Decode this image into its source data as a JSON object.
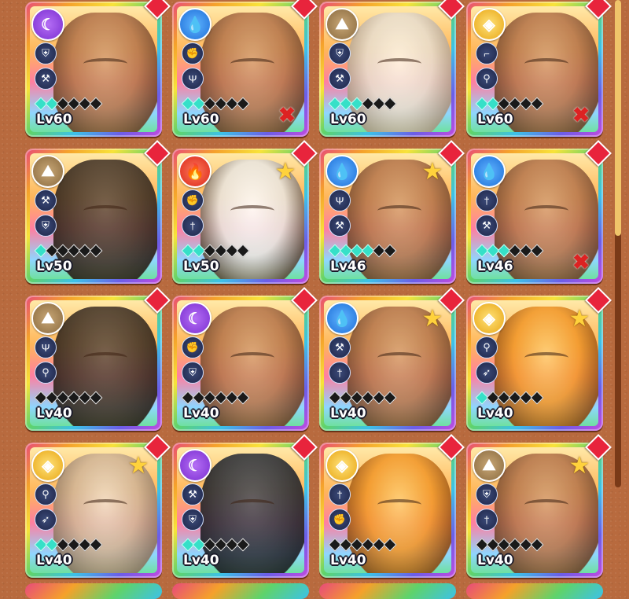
{
  "roster": {
    "cards": [
      {
        "level": "Lv60",
        "element": "el-moon",
        "element_glyph": "☾",
        "fur": "",
        "skills": [
          "shield-icon",
          "axe-icon"
        ],
        "rank": 2,
        "star": false,
        "xmark": false
      },
      {
        "level": "Lv60",
        "element": "el-water",
        "element_glyph": "💧",
        "fur": "",
        "skills": [
          "fist-icon",
          "trident-icon"
        ],
        "rank": 2,
        "star": false,
        "xmark": true
      },
      {
        "level": "Lv60",
        "element": "el-earth",
        "element_glyph": "⛰",
        "fur": "fur-white",
        "skills": [
          "shield-icon",
          "axe-icon"
        ],
        "rank": 3,
        "star": false,
        "xmark": false
      },
      {
        "level": "Lv60",
        "element": "el-light",
        "element_glyph": "◈",
        "fur": "",
        "skills": [
          "gun-icon",
          "staff-icon"
        ],
        "rank": 2,
        "star": false,
        "xmark": true
      },
      {
        "level": "Lv50",
        "element": "el-earth",
        "element_glyph": "⛰",
        "fur": "fur-dark",
        "skills": [
          "axe-icon",
          "shield-icon"
        ],
        "rank": 1,
        "star": false,
        "xmark": false
      },
      {
        "level": "Lv50",
        "element": "el-fire",
        "element_glyph": "🔥",
        "fur": "fur-panda",
        "skills": [
          "fist-icon",
          "sword-icon"
        ],
        "rank": 2,
        "star": true,
        "xmark": false
      },
      {
        "level": "Lv46",
        "element": "el-water",
        "element_glyph": "💧",
        "fur": "",
        "skills": [
          "trident-icon",
          "axe-icon"
        ],
        "rank": 4,
        "star": true,
        "xmark": false
      },
      {
        "level": "Lv46",
        "element": "el-water",
        "element_glyph": "💧",
        "fur": "",
        "skills": [
          "sword-icon",
          "axe-icon"
        ],
        "rank": 3,
        "star": false,
        "xmark": true
      },
      {
        "level": "Lv40",
        "element": "el-earth",
        "element_glyph": "⛰",
        "fur": "fur-dark",
        "skills": [
          "trident-icon",
          "staff-icon"
        ],
        "rank": 0,
        "star": false,
        "xmark": false
      },
      {
        "level": "Lv40",
        "element": "el-moon",
        "element_glyph": "☾",
        "fur": "",
        "skills": [
          "fist-icon",
          "shield-icon"
        ],
        "rank": 0,
        "star": false,
        "xmark": false
      },
      {
        "level": "Lv40",
        "element": "el-water",
        "element_glyph": "💧",
        "fur": "",
        "skills": [
          "axe-icon",
          "sword-icon"
        ],
        "rank": 0,
        "star": true,
        "xmark": false
      },
      {
        "level": "Lv40",
        "element": "el-light",
        "element_glyph": "◈",
        "fur": "fur-tiger",
        "skills": [
          "staff-icon",
          "bow-icon"
        ],
        "rank": 1,
        "star": true,
        "xmark": false
      },
      {
        "level": "Lv40",
        "element": "el-light",
        "element_glyph": "◈",
        "fur": "fur-elder",
        "skills": [
          "staff-icon",
          "bow-icon"
        ],
        "rank": 2,
        "star": true,
        "xmark": false
      },
      {
        "level": "Lv40",
        "element": "el-moon",
        "element_glyph": "☾",
        "fur": "fur-black",
        "skills": [
          "axe-icon",
          "shield-icon"
        ],
        "rank": 2,
        "star": false,
        "xmark": false
      },
      {
        "level": "Lv40",
        "element": "el-light",
        "element_glyph": "◈",
        "fur": "fur-tiger",
        "skills": [
          "sword-icon",
          "fist-icon"
        ],
        "rank": 0,
        "star": false,
        "xmark": false
      },
      {
        "level": "Lv40",
        "element": "el-earth",
        "element_glyph": "⛰",
        "fur": "",
        "skills": [
          "shield-icon",
          "sword-icon"
        ],
        "rank": 0,
        "star": true,
        "xmark": false
      }
    ]
  },
  "colors": {
    "background": "#b86a3e",
    "rank_gem_on": "#36e0c8",
    "new_marker": "#e8243c"
  }
}
